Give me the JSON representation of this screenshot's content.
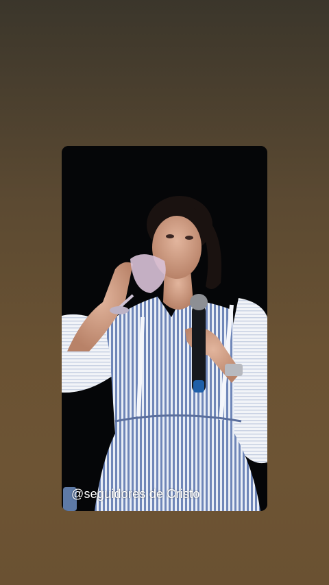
{
  "story": {
    "media_description_icon": "speaker-drinking-video",
    "watermark": "@seguidores de Cristo"
  },
  "colors": {
    "background_top": "#3b362b",
    "background_bottom": "#6a5132",
    "stage_black": "#050608",
    "dress_blue": "#8fa3c9"
  }
}
